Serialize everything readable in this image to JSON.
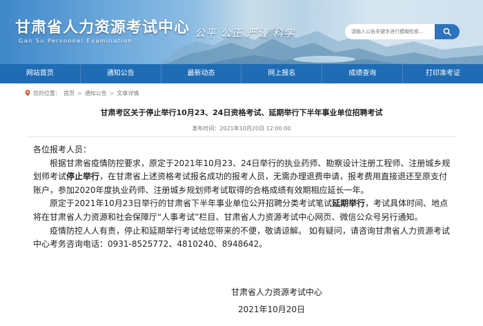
{
  "header": {
    "title": "甘肃省人力资源考试中心",
    "subtitle": "Gan Su Personnel Examination",
    "slogan": "公平 公正 严谨 科学",
    "search_placeholder": "请输入公告关键字进行模糊检索..."
  },
  "nav": {
    "items": [
      "网站首页",
      "通知公告",
      "最新动态",
      "网上报名",
      "成绩查询",
      "打印准考证"
    ]
  },
  "breadcrumb": {
    "prefix": "您的位置：",
    "items": [
      "首页",
      "通知公告",
      "文章详情"
    ],
    "separator": ">"
  },
  "article": {
    "title": "甘肃考区关于停止举行10月23、24日资格考试、延期举行下半年事业单位招聘考试",
    "meta": "发布时间：2021年10月20日 12:00:00",
    "greeting": "各位报考人员：",
    "p1_a": "根据甘肃省疫情防控要求，原定于2021年10月23、24日举行的执业药师、勘察设计注册工程师、注册城乡规划师考试",
    "p1_b": "停止举行",
    "p1_c": "，在甘肃省上述资格考试报名成功的报考人员，无需办理退费申请，报考费用直接退还至原支付账户，参加2020年度执业药师、注册城乡规划师考试取得的合格成绩有效期相应延长一年。",
    "p2_a": "原定于2021年10月23日举行的甘肃省下半年事业单位公开招聘分类考试笔试",
    "p2_b": "延期举行",
    "p2_c": "，考试具体时间、地点将在甘肃省人力资源和社会保障厅“人事考试”栏目、甘肃省人力资源考试中心网页、微信公众号另行通知。",
    "p3": "疫情防控人人有责，停止和延期举行考试给您带来的不便，敬请谅解。 如有疑问，请咨询甘肃省人力资源考试中心考务咨询电话：0931-8525772、4810240、8948642。",
    "signature": "甘肃省人力资源考试中心",
    "date": "2021年10月20日"
  },
  "colors": {
    "nav_bg": "#1f6cb5",
    "search_btn": "#2d73bd"
  }
}
